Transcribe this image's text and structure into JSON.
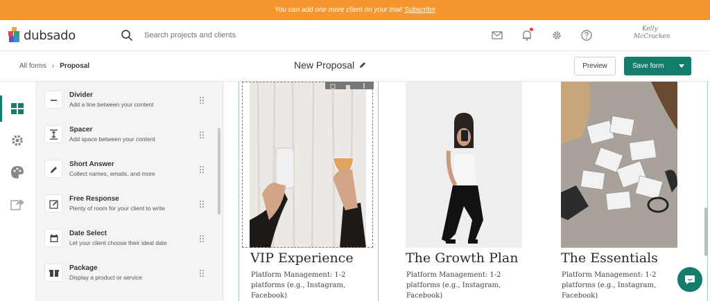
{
  "banner": {
    "text": "You can add one more client on your trial",
    "link": "Subscribe"
  },
  "brand": {
    "name": "dubsado",
    "accent": "#137c6b",
    "banner_color": "#f5962e"
  },
  "search": {
    "placeholder": "Search projects and clients"
  },
  "top_icons": [
    "mail-icon",
    "bell-icon",
    "gear-icon",
    "help-icon"
  ],
  "user": {
    "signature_line1": "Kelly",
    "signature_line2": "McCracken"
  },
  "breadcrumb": {
    "root": "All forms",
    "separator": "›",
    "current": "Proposal"
  },
  "page_title": "New Proposal",
  "toolbar": {
    "preview_label": "Preview",
    "save_label": "Save form"
  },
  "rail": [
    "grid-icon",
    "settings-icon",
    "palette-icon",
    "share-icon"
  ],
  "elements": [
    {
      "name": "Divider",
      "desc": "Add a line between your content",
      "icon": "minus-icon"
    },
    {
      "name": "Spacer",
      "desc": "Add space between your content",
      "icon": "spacer-icon"
    },
    {
      "name": "Short Answer",
      "desc": "Collect names, emails, and more",
      "icon": "pencil-icon"
    },
    {
      "name": "Free Response",
      "desc": "Plenty of room for your client to write",
      "icon": "edit-box-icon"
    },
    {
      "name": "Date Select",
      "desc": "Let your client choose their ideal date",
      "icon": "calendar-icon"
    },
    {
      "name": "Package",
      "desc": "Display a product or service",
      "icon": "package-icon"
    }
  ],
  "cards": [
    {
      "title": "VIP Experience",
      "body": "Platform Management: 1-2 platforms (e.g., Instagram, Facebook)"
    },
    {
      "title": "The Growth Plan",
      "body": "Platform Management: 1-2 platforms (e.g., Instagram, Facebook)"
    },
    {
      "title": "The Essentials",
      "body": "Platform Management: 1-2 platforms (e.g., Instagram, Facebook)"
    }
  ]
}
